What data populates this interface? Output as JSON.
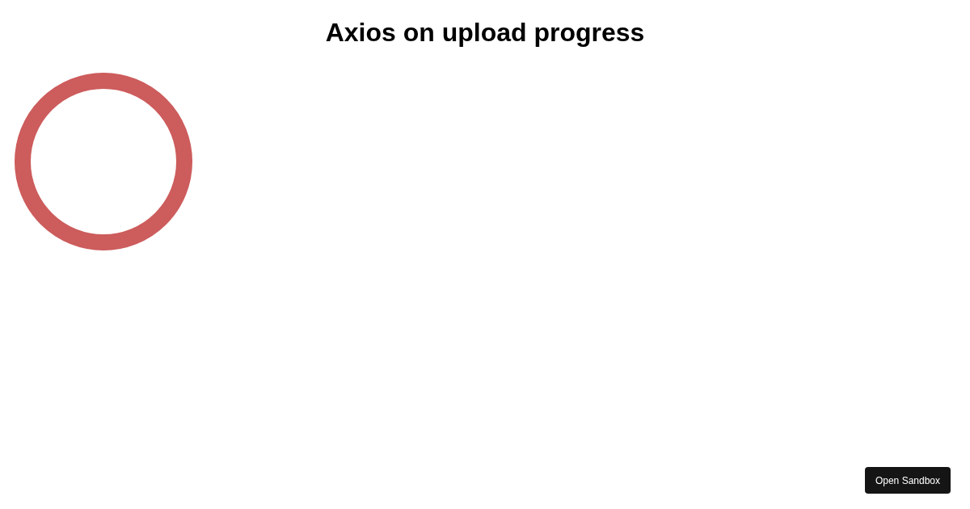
{
  "title": "Axios on upload progress",
  "sandbox_button": {
    "label": "Open Sandbox"
  }
}
